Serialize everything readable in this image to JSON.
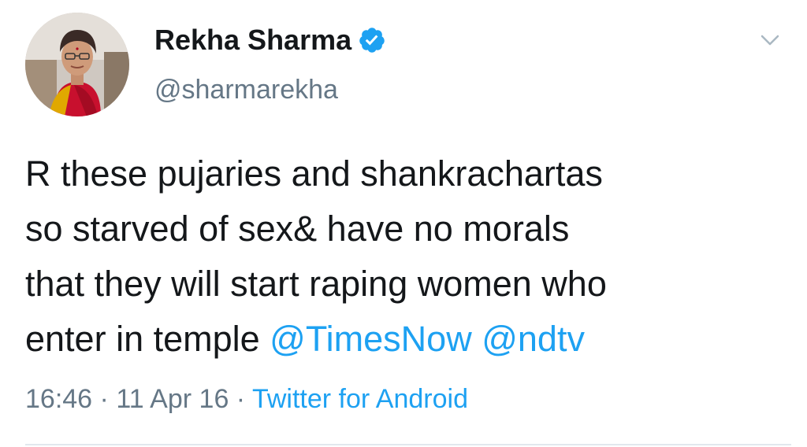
{
  "tweet": {
    "author": {
      "display_name": "Rekha Sharma",
      "handle": "@sharmarekha",
      "verified": true
    },
    "text_lines": [
      "R these pujaries and shankrachartas",
      "so starved of sex& have no morals",
      "that they will start raping women who",
      "enter in temple "
    ],
    "mentions": [
      "@TimesNow",
      "@ndtv"
    ],
    "meta": {
      "time": "16:46",
      "separator": " · ",
      "date": "11 Apr 16",
      "source": "Twitter for Android"
    }
  },
  "icons": {
    "verified": "verified-badge-icon",
    "menu": "chevron-down-icon",
    "avatar": "profile-photo"
  },
  "colors": {
    "text": "#14171a",
    "secondary": "#657786",
    "link": "#1da1f2",
    "verified": "#1da1f2",
    "divider": "#e1e8ed"
  }
}
